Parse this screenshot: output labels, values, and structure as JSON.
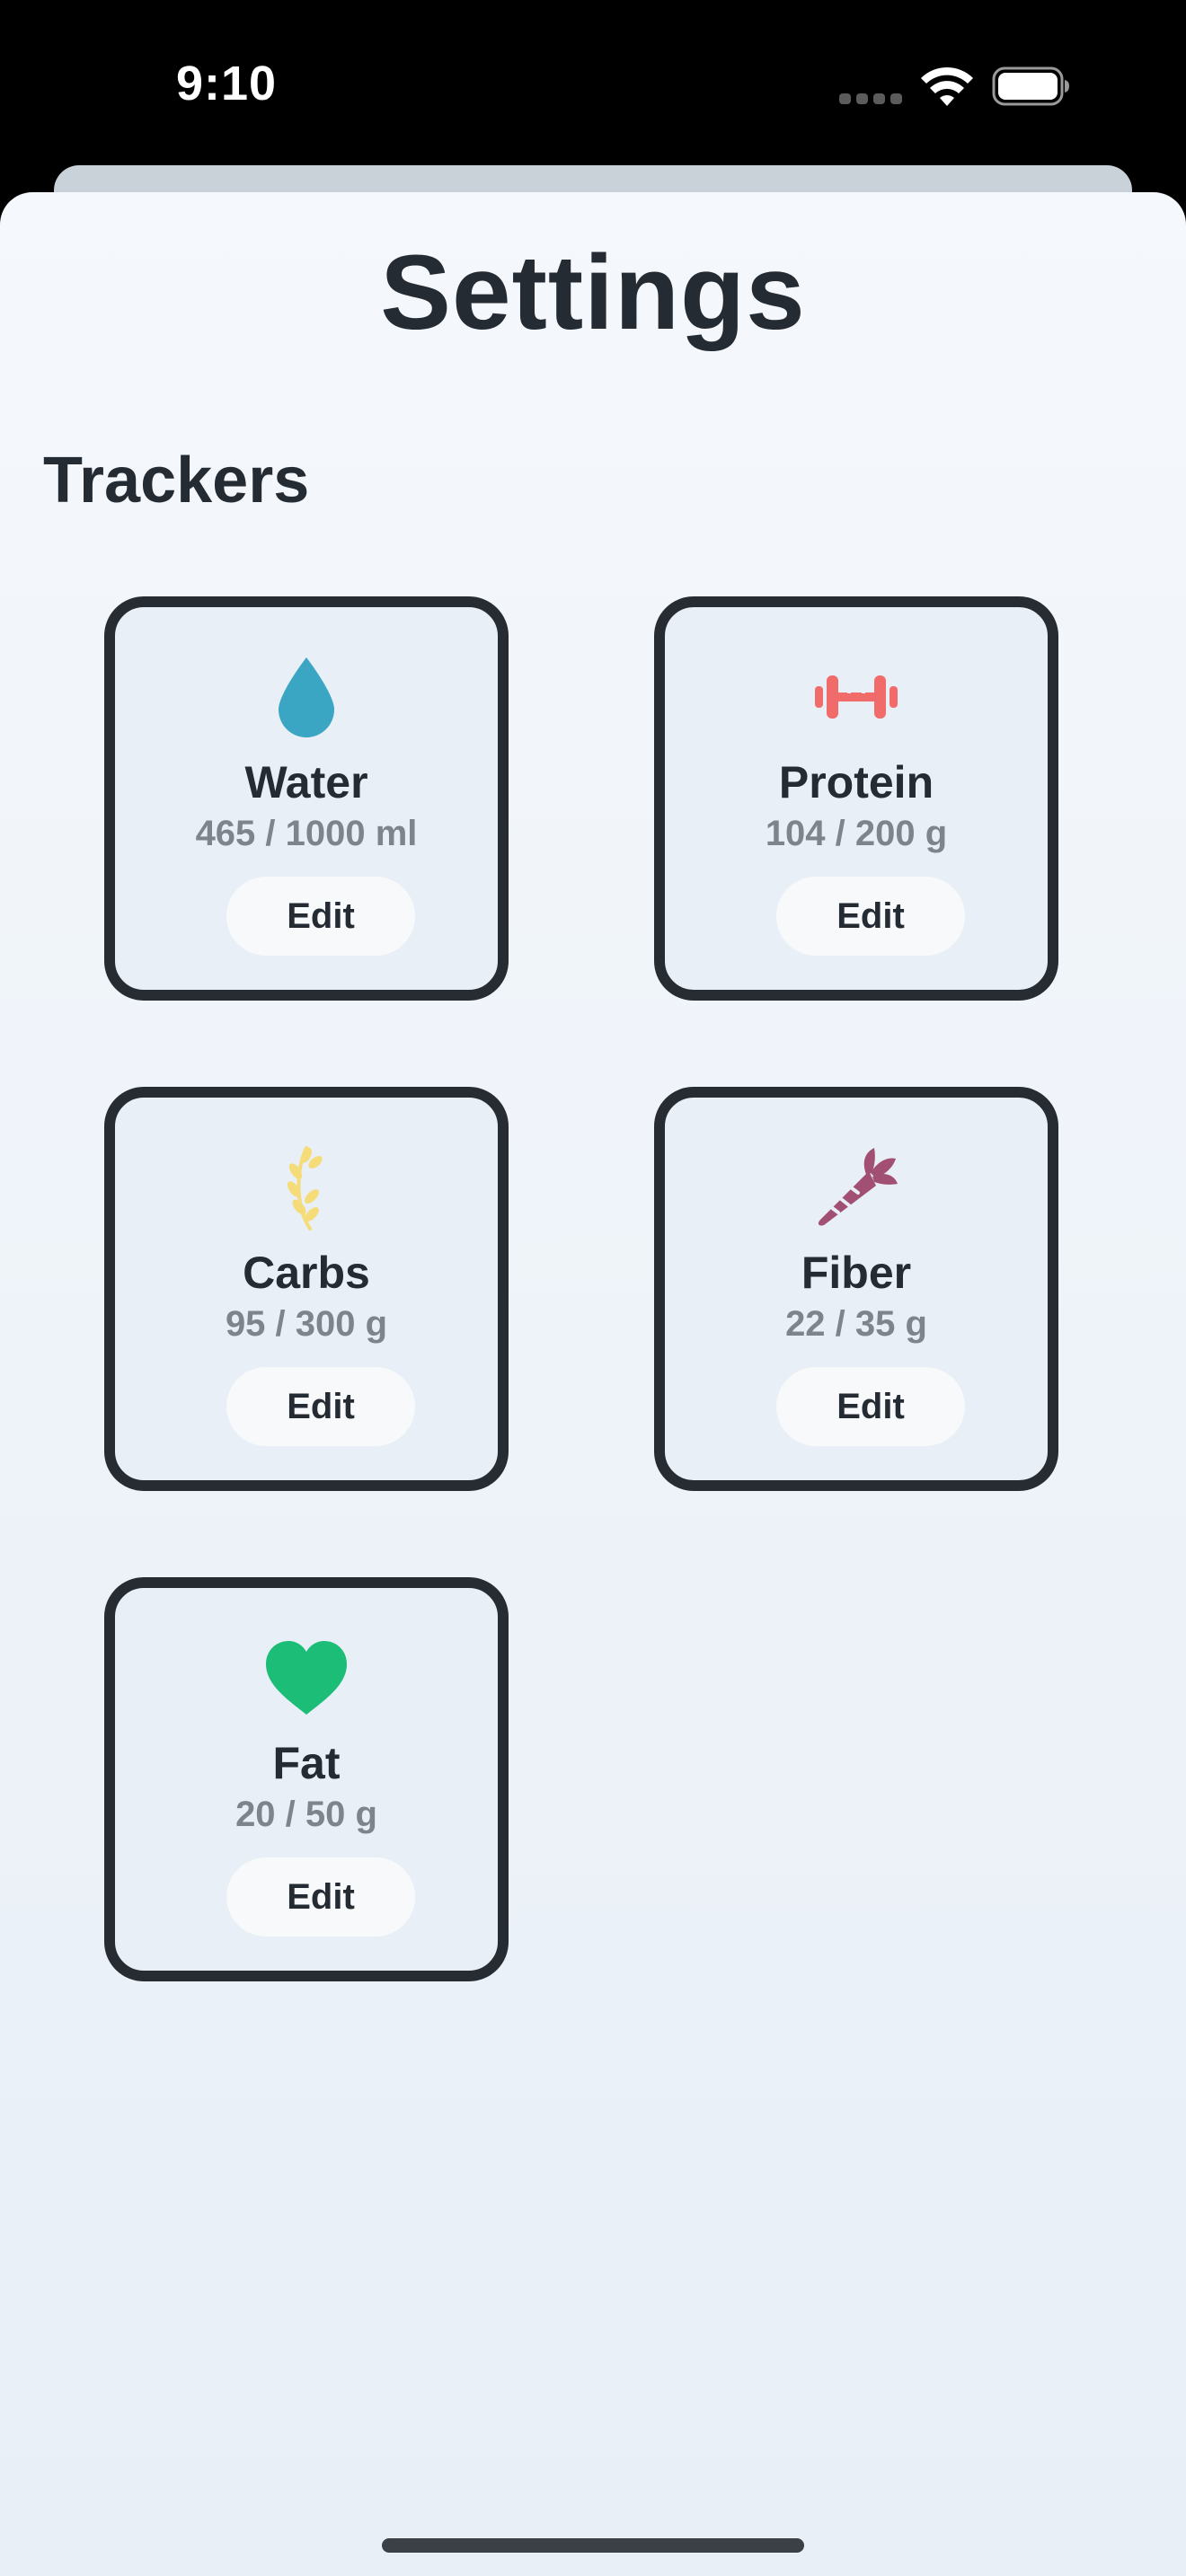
{
  "status_bar": {
    "time": "9:10"
  },
  "page": {
    "title": "Settings",
    "section_title": "Trackers"
  },
  "trackers": [
    {
      "name": "Water",
      "value": "465 / 1000 ml",
      "edit_label": "Edit",
      "icon": "water-drop-icon",
      "icon_color": "#3ba5c4"
    },
    {
      "name": "Protein",
      "value": "104 / 200 g",
      "edit_label": "Edit",
      "icon": "dumbbell-icon",
      "icon_color": "#f26b6b"
    },
    {
      "name": "Carbs",
      "value": "95 / 300 g",
      "edit_label": "Edit",
      "icon": "wheat-icon",
      "icon_color": "#f5dc78"
    },
    {
      "name": "Fiber",
      "value": "22 / 35 g",
      "edit_label": "Edit",
      "icon": "carrot-icon",
      "icon_color": "#a14f72"
    },
    {
      "name": "Fat",
      "value": "20 / 50 g",
      "edit_label": "Edit",
      "icon": "heart-icon",
      "icon_color": "#1cbd76"
    }
  ],
  "colors": {
    "card_border": "#272c33",
    "card_background": "#e8eff6",
    "text_primary": "#252b33",
    "text_secondary": "#7d848c"
  }
}
